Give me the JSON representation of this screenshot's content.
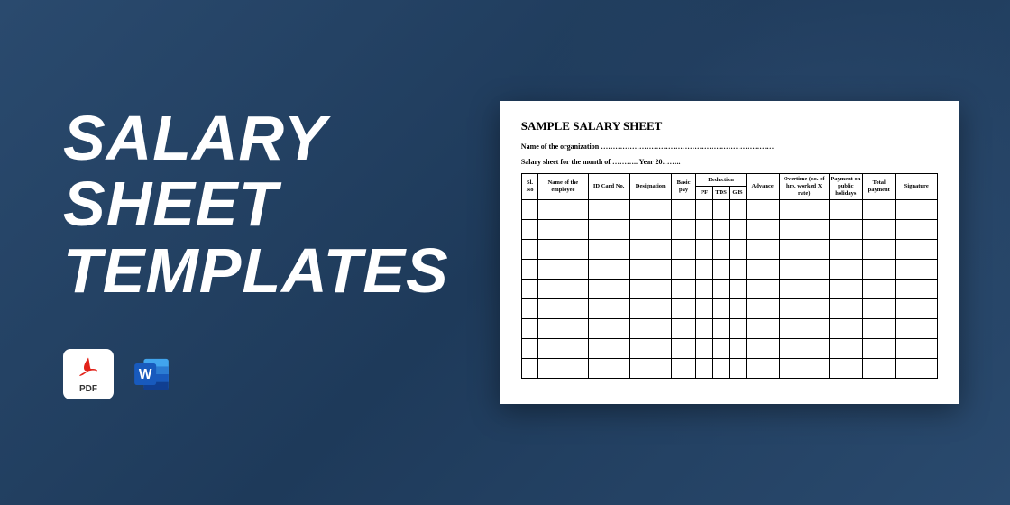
{
  "title_lines": [
    "SALARY",
    "SHEET",
    "TEMPLATES"
  ],
  "icons": {
    "pdf_label": "PDF",
    "word_label": "Word"
  },
  "document": {
    "heading": "SAMPLE SALARY SHEET",
    "org_line": "Name of the organization ………………………………………………………………",
    "month_line": "Salary sheet for the month of ………..  Year 20……..",
    "headers": {
      "sl": "Sl. No",
      "name": "Name of the employee",
      "id": "ID Card No.",
      "designation": "Designation",
      "basic": "Basic pay",
      "deduction": "Deduction",
      "pf": "PF",
      "tds": "TDS",
      "gis": "GIS",
      "advance": "Advance",
      "overtime": "Overtime (no. of hrs. worked X rate)",
      "payment_holidays": "Payment on public holidays",
      "total": "Total payment",
      "signature": "Signature"
    },
    "empty_rows": 9
  }
}
